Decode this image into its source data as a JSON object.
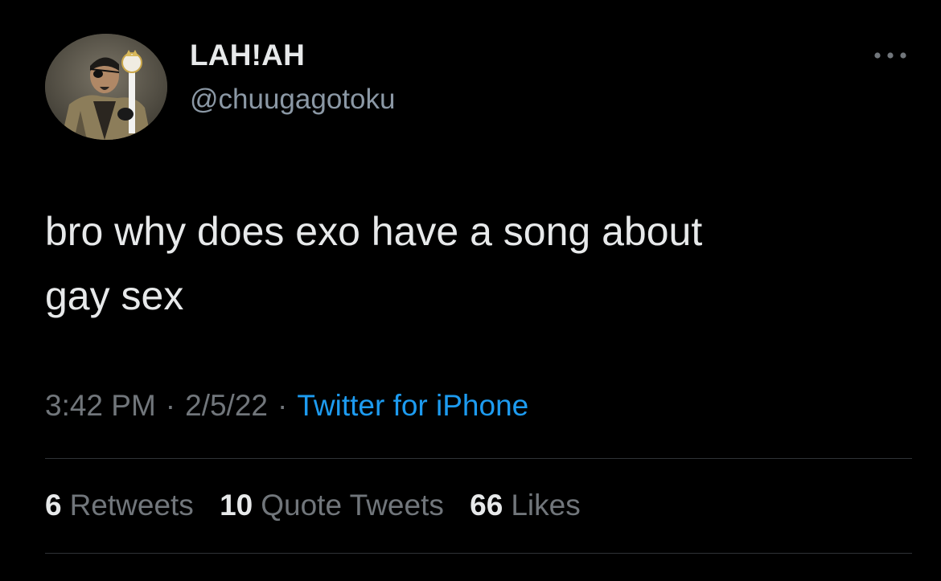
{
  "author": {
    "name": "LAH!AH",
    "handle": "@chuugagotoku"
  },
  "tweet": {
    "text_line1": "bro why does exo have a song about",
    "text_line2": "gay sex"
  },
  "meta": {
    "time": "3:42 PM",
    "separator1": "·",
    "date": "2/5/22",
    "separator2": "·",
    "source": "Twitter for iPhone"
  },
  "stats": {
    "retweets_count": "6",
    "retweets_label": "Retweets",
    "quotes_count": "10",
    "quotes_label": "Quote Tweets",
    "likes_count": "66",
    "likes_label": "Likes"
  },
  "icons": {
    "more": "more-horizontal-icon"
  },
  "colors": {
    "background": "#000000",
    "primary_text": "#e7e9ea",
    "secondary_text": "#71767b",
    "link": "#1d9bf0",
    "divider": "#2f3336"
  }
}
